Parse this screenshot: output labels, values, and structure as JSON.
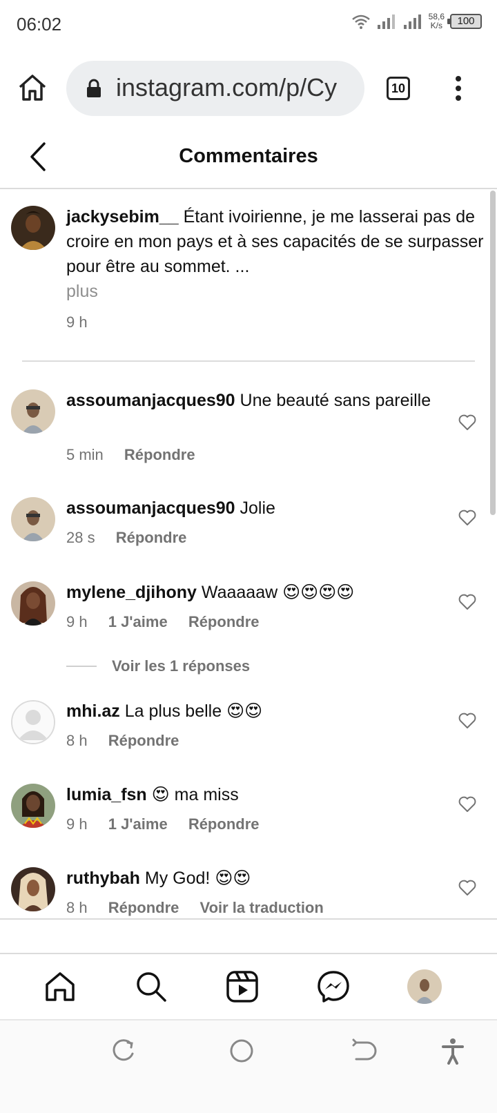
{
  "status_bar": {
    "time": "06:02",
    "net_speed_value": "58,6",
    "net_speed_unit": "K/s",
    "battery": "100"
  },
  "browser": {
    "url": "instagram.com/p/Cy",
    "tab_count": "10"
  },
  "header": {
    "title": "Commentaires"
  },
  "caption": {
    "username": "jackysebim__",
    "text": "Étant ivoirienne, je me lasserai pas de croire en mon pays et à ses capacités de se surpasser pour être au sommet. ...",
    "more": "plus",
    "time": "9 h"
  },
  "comments": [
    {
      "username": "assoumanjacques90",
      "text": "Une beauté sans pareille",
      "time": "5 min",
      "likes": "",
      "reply": "Répondre"
    },
    {
      "username": "assoumanjacques90",
      "text": "Jolie",
      "time": "28 s",
      "likes": "",
      "reply": "Répondre"
    },
    {
      "username": "mylene_djihony",
      "text": "Waaaaaw",
      "emoji": "😍😍😍😍",
      "time": "9 h",
      "likes": "1 J'aime",
      "reply": "Répondre"
    },
    {
      "username": "mhi.az",
      "text": "La plus belle",
      "emoji": "😍😍",
      "time": "8 h",
      "likes": "",
      "reply": "Répondre"
    },
    {
      "username": "lumia_fsn",
      "emoji_before": "😍",
      "text": "ma miss",
      "time": "9 h",
      "likes": "1 J'aime",
      "reply": "Répondre"
    },
    {
      "username": "ruthybah",
      "text": "My God!",
      "emoji": "😍😍",
      "time": "8 h",
      "likes": "",
      "reply": "Répondre",
      "translate": "Voir la traduction"
    }
  ],
  "replies_link": "Voir les 1 réponses",
  "icons": {
    "browser_home": "home-icon",
    "lock": "lock-icon",
    "menu": "kebab-menu-icon",
    "back": "back-arrow-icon",
    "like": "heart-icon",
    "nav_home": "home-icon",
    "nav_search": "search-icon",
    "nav_reels": "reels-icon",
    "nav_messenger": "messenger-icon",
    "sys_recent": "recent-apps-icon",
    "sys_home": "system-home-icon",
    "sys_back": "system-back-icon",
    "sys_accessibility": "accessibility-icon"
  },
  "colors": {
    "text": "#111111",
    "secondary": "#737373",
    "divider": "#dbdbdb",
    "url_bg": "#eceef0"
  }
}
